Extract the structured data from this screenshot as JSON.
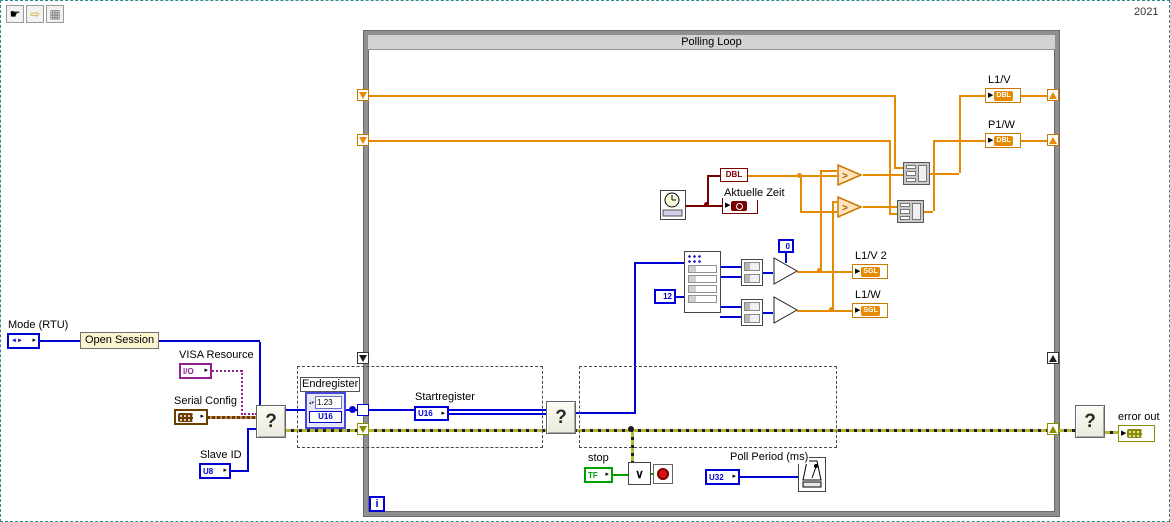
{
  "window": {
    "year_badge": "2021"
  },
  "icons": {
    "hand_tool": "☛",
    "run_tool": "⇨",
    "grid_tool": "▦",
    "control_arrow": "▸",
    "indicator_arrow": "▶",
    "greater": ">",
    "or_glyph": "∨",
    "mode_glyph": "◄►"
  },
  "loop": {
    "title": "Polling Loop",
    "iteration_terminal": "i"
  },
  "controls": {
    "mode": {
      "label": "Mode (RTU)"
    },
    "open_session": {
      "label": "Open Session"
    },
    "visa_resource": {
      "label": "VISA Resource",
      "type": "I/O"
    },
    "serial_config": {
      "label": "Serial Config"
    },
    "slave_id": {
      "label": "Slave ID",
      "type": "U8"
    },
    "endregister": {
      "label": "Endregister",
      "value_display": "1.23",
      "type": "U16"
    },
    "startregister": {
      "label": "Startregister",
      "type": "U16"
    },
    "stop": {
      "label": "stop",
      "type": "TF"
    },
    "poll_period": {
      "label": "Poll Period (ms)",
      "type": "U32"
    }
  },
  "constants": {
    "zero": "0",
    "twelve": "12"
  },
  "functions": {
    "to_double": "DBL",
    "subvi_glyph": "?"
  },
  "indicators": {
    "l1v": {
      "label": "L1/V",
      "type": "DBL"
    },
    "p1w": {
      "label": "P1/W",
      "type": "DBL"
    },
    "l1v2": {
      "label": "L1/V 2",
      "type": "SGL"
    },
    "l1w": {
      "label": "L1/W",
      "type": "SGL"
    },
    "aktuelle_zeit": {
      "label": "Aktuelle Zeit"
    },
    "error_out": {
      "label": "error out"
    }
  },
  "colors": {
    "double_orange": "#E68A00",
    "integer_blue": "#0000D6",
    "visa_purple": "#90218F",
    "cluster_brown": "#6B3E00",
    "boolean_green": "#00A000",
    "error_olive": "#8B8B00",
    "timestamp_maroon": "#7A0000",
    "loop_gray": "#8F8F8F"
  }
}
